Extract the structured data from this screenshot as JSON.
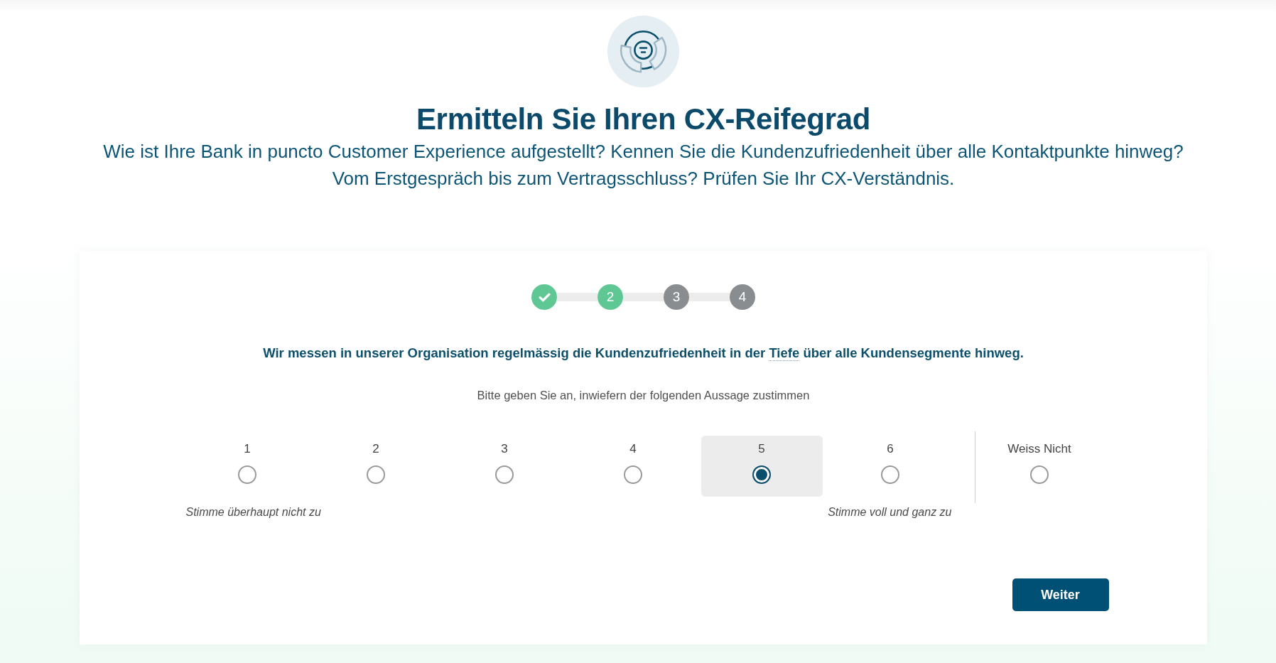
{
  "header": {
    "title": "Ermitteln Sie Ihren CX-Reifegrad",
    "subtitle_lines": [
      "Wie ist Ihre Bank in puncto Customer Experience aufgestellt? Kennen Sie die Kundenzufriedenheit über alle Kontaktpunkte hinweg?",
      "Vom Erstgespräch bis zum Vertragsschluss? Prüfen Sie Ihr CX-Verständnis."
    ]
  },
  "steps": [
    {
      "kind": "done"
    },
    {
      "kind": "current",
      "label": "2"
    },
    {
      "kind": "upcoming",
      "label": "3"
    },
    {
      "kind": "upcoming",
      "label": "4"
    }
  ],
  "question": {
    "before": "Wir messen in unserer Organisation regelmässig die Kundenzufriedenheit in der",
    "term": "Tiefe",
    "after": "über alle Kundensegmente hinweg."
  },
  "instruction": "Bitte geben Sie an, inwiefern der folgenden Aussage zustimmen",
  "scale": {
    "options": [
      {
        "label": "1",
        "selected": false
      },
      {
        "label": "2",
        "selected": false
      },
      {
        "label": "3",
        "selected": false
      },
      {
        "label": "4",
        "selected": false
      },
      {
        "label": "5",
        "selected": true
      },
      {
        "label": "6",
        "selected": false
      }
    ],
    "min_label": "Stimme überhaupt nicht zu",
    "max_label": "Stimme voll und ganz zu",
    "extra_option": {
      "label": "Weiss Nicht",
      "selected": false
    }
  },
  "next_button": {
    "label": "Weiter"
  }
}
